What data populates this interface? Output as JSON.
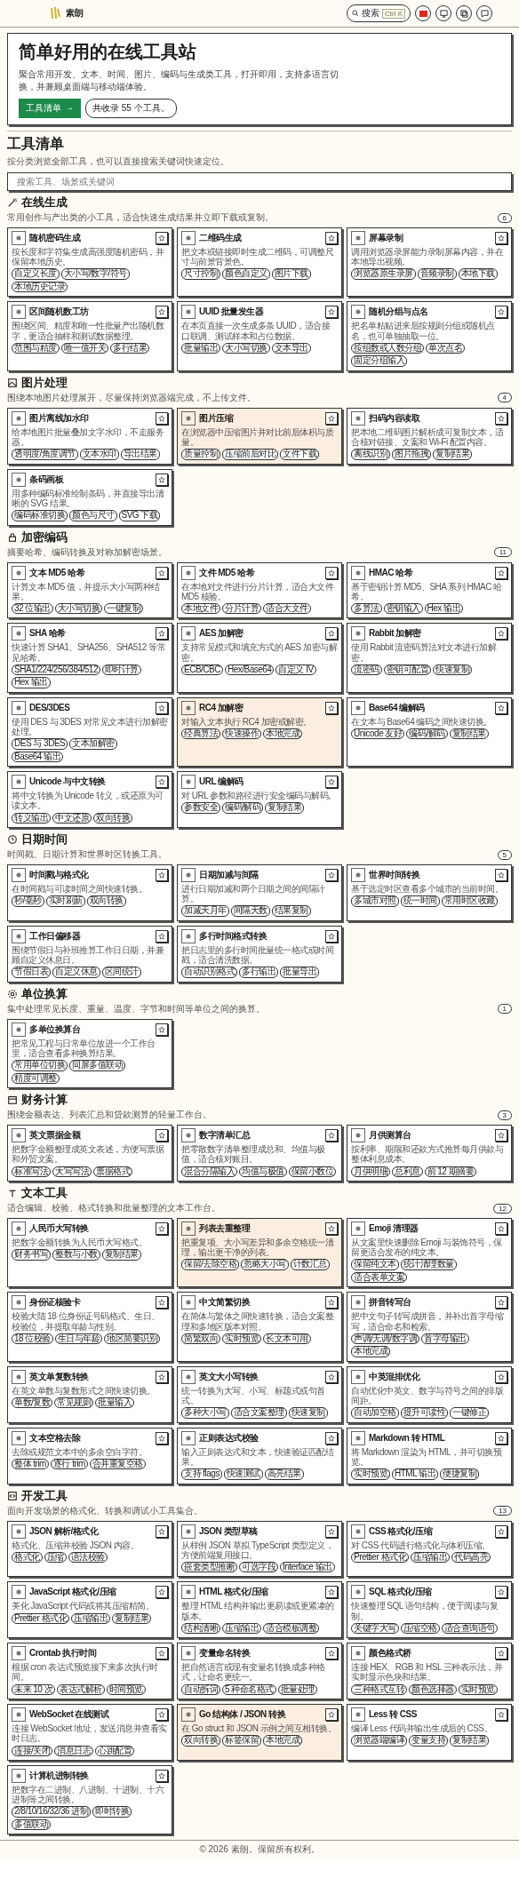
{
  "header": {
    "brand": "素朗",
    "search": {
      "label": "搜索",
      "shortcut": "Ctrl K"
    }
  },
  "hero": {
    "title": "简单好用的在线工具站",
    "description": "聚合常用开发、文本、时间、图片、编码与生成类工具，打开即用，支持多语言切换，并兼顾桌面端与移动端体验。",
    "primary_button": {
      "label": "工具清单",
      "arrow": "→"
    },
    "count_badge": "共收录 55 个工具。"
  },
  "catalog": {
    "title": "工具清单",
    "description": "按分类浏览全部工具，也可以直接搜索关键词快速定位。",
    "search": {
      "placeholder": "搜索工具、场景或关键词"
    }
  },
  "sections": [
    {
      "title": "在线生成",
      "description": "常用创作与产出类的小工具，适合快速生成结果并立即下载或复制。",
      "count": "6",
      "tools": [
        {
          "name": "随机密码生成",
          "description": "按长度和字符集生成高强度随机密码，并保留本地历史。",
          "tags": [
            "自定义长度",
            "大小写/数字/符号",
            "本地历史记录"
          ],
          "highlighted": false
        },
        {
          "name": "二维码生成",
          "description": "把文本或链接即时生成二维码，可调整尺寸与前景背景色。",
          "tags": [
            "尺寸控制",
            "颜色自定义",
            "图片下载"
          ],
          "highlighted": false
        },
        {
          "name": "屏幕录制",
          "description": "调用浏览器录屏能力录制屏幕内容，并在本地导出视频。",
          "tags": [
            "浏览器原生录屏",
            "音频录制",
            "本地下载"
          ],
          "highlighted": false
        },
        {
          "name": "区间随机数工坊",
          "description": "围绕区间、精度和唯一性批量产出随机数字，更适合抽样和测试数据整理。",
          "tags": [
            "范围与精度",
            "唯一值开关",
            "多行结果"
          ],
          "highlighted": false
        },
        {
          "name": "UUID 批量发生器",
          "description": "在本页直接一次生成多条 UUID，适合接口联调、测试样本和占位数据。",
          "tags": [
            "批量输出",
            "大小写切换",
            "文本导出"
          ],
          "highlighted": false
        },
        {
          "name": "随机分组与点名",
          "description": "把名单粘贴进来后按规则分组或随机点名，也可单独抽取一位。",
          "tags": [
            "按组数或人数分组",
            "单次点名",
            "固定分组输入"
          ],
          "highlighted": false
        }
      ]
    },
    {
      "title": "图片处理",
      "description": "围绕本地图片处理展开，尽量保持浏览器端完成，不上传文件。",
      "count": "4",
      "tools": [
        {
          "name": "图片离线加水印",
          "description": "给本地图片批量叠加文字水印，不走服务器。",
          "tags": [
            "透明度/角度调节",
            "文本水印",
            "导出结果"
          ],
          "highlighted": false
        },
        {
          "name": "图片压缩",
          "description": "在浏览器中压缩图片并对比前后体积与质量。",
          "tags": [
            "质量控制",
            "压缩前后对比",
            "文件下载"
          ],
          "highlighted": true
        },
        {
          "name": "扫码内容读取",
          "description": "把本地二维码图片解析成可复制文本，适合核对链接、文案和 Wi-Fi 配置内容。",
          "tags": [
            "离线识别",
            "图片拖拽",
            "复制结果"
          ],
          "highlighted": false
        },
        {
          "name": "条码画板",
          "description": "用多种编码标准绘制条码，并直接导出清晰的 SVG 结果。",
          "tags": [
            "编码标准切换",
            "颜色与尺寸",
            "SVG 下载"
          ],
          "highlighted": false
        }
      ]
    },
    {
      "title": "加密编码",
      "description": "摘要哈希、编码转换及对称加解密场景。",
      "count": "11",
      "tools": [
        {
          "name": "文本 MD5 哈希",
          "description": "计算文本 MD5 值，并提示大小写两种结果。",
          "tags": [
            "32 位输出",
            "大小写切换",
            "一键复制"
          ],
          "highlighted": false
        },
        {
          "name": "文件 MD5 哈希",
          "description": "在本地对文件进行分片计算，适合大文件 MD5 核验。",
          "tags": [
            "本地文件",
            "分片计算",
            "适合大文件"
          ],
          "highlighted": false
        },
        {
          "name": "HMAC 哈希",
          "description": "基于密钥计算 MD5、SHA 系列 HMAC 哈希。",
          "tags": [
            "多算法",
            "密钥输入",
            "Hex 输出"
          ],
          "highlighted": false
        },
        {
          "name": "SHA 哈希",
          "description": "快速计算 SHA1、SHA256、SHA512 等常见哈希。",
          "tags": [
            "SHA1/224/256/384/512",
            "即时计算",
            "Hex 输出"
          ],
          "highlighted": false
        },
        {
          "name": "AES 加解密",
          "description": "支持常见模式和填充方式的 AES 加密与解密。",
          "tags": [
            "ECB/CBC",
            "Hex/Base64",
            "自定义 IV"
          ],
          "highlighted": false
        },
        {
          "name": "Rabbit 加解密",
          "description": "使用 Rabbit 流密码算法对文本进行加解密。",
          "tags": [
            "流密码",
            "密钥可配置",
            "快速复制"
          ],
          "highlighted": false
        },
        {
          "name": "DES/3DES",
          "description": "使用 DES 与 3DES 对常见文本进行加解密处理。",
          "tags": [
            "DES 与 3DES",
            "文本加解密",
            "Base64 输出"
          ],
          "highlighted": false
        },
        {
          "name": "RC4 加解密",
          "description": "对输入文本执行 RC4 加密或解密。",
          "tags": [
            "经典算法",
            "快速操作",
            "本地完成"
          ],
          "highlighted": true
        },
        {
          "name": "Base64 编解码",
          "description": "在文本与 Base64 编码之间快速切换。",
          "tags": [
            "Unicode 友好",
            "编码/解码",
            "复制结果"
          ],
          "highlighted": false
        },
        {
          "name": "Unicode 与中文转换",
          "description": "将中文转换为 Unicode 转义，或还原为可读文本。",
          "tags": [
            "转义输出",
            "中文还原",
            "双向转换"
          ],
          "highlighted": false
        },
        {
          "name": "URL 编解码",
          "description": "对 URL 参数和路径进行安全编码与解码。",
          "tags": [
            "参数安全",
            "编码/解码",
            "复制结果"
          ],
          "highlighted": false
        }
      ]
    },
    {
      "title": "日期时间",
      "description": "时间戳、日期计算和世界时区转换工具。",
      "count": "5",
      "tools": [
        {
          "name": "时间戳与格式化",
          "description": "在时间戳与可读时间之间快速转换。",
          "tags": [
            "秒/毫秒",
            "实时刷新",
            "双向转换"
          ],
          "highlighted": false
        },
        {
          "name": "日期加减与间隔",
          "description": "进行日期加减和两个日期之间的间隔计算。",
          "tags": [
            "加减天月年",
            "间隔天数",
            "结果复制"
          ],
          "highlighted": false
        },
        {
          "name": "世界时间转换",
          "description": "基于选定时区查看多个城市的当前时间。",
          "tags": [
            "多城市对照",
            "统一时间",
            "常用时区收藏"
          ],
          "highlighted": false
        },
        {
          "name": "工作日偏移器",
          "description": "围绕节假日与补班推算工作日日期，并兼顾自定义休息日。",
          "tags": [
            "节假日表",
            "自定义休息",
            "区间统计"
          ],
          "highlighted": false
        },
        {
          "name": "多行时间格式转换",
          "description": "把日志里的多行时间批量统一格式或时间戳，适合清洗数据。",
          "tags": [
            "自动识别格式",
            "多行输出",
            "批量导出"
          ],
          "highlighted": false
        }
      ]
    },
    {
      "title": "单位换算",
      "description": "集中处理常见长度、重量、温度、字节和时间等单位之间的换算。",
      "count": "1",
      "tools": [
        {
          "name": "多单位换算台",
          "description": "把常见工程与日常单位放进一个工作台里，适合查看多种换算结果。",
          "tags": [
            "常用单位切换",
            "同屏多值联动",
            "精度可调整"
          ],
          "highlighted": false
        }
      ]
    },
    {
      "title": "财务计算",
      "description": "围绕金额表达、列表汇总和贷款测算的轻量工作台。",
      "count": "3",
      "tools": [
        {
          "name": "英文票据金额",
          "description": "把数字金额整理成英文表述，方便写票据和外贸文案。",
          "tags": [
            "标准写法",
            "大写写法",
            "票据格式"
          ],
          "highlighted": false
        },
        {
          "name": "数字清单汇总",
          "description": "把零散数字清单整理成总和、均值与极值，适合核对账目。",
          "tags": [
            "混合分隔输入",
            "均值与极值",
            "保留小数位"
          ],
          "highlighted": false
        },
        {
          "name": "月供测算台",
          "description": "按利率、期限和还款方式推算每月供款与整体利息成本。",
          "tags": [
            "月供明细",
            "总利息",
            "前 12 期摘要"
          ],
          "highlighted": false
        }
      ]
    },
    {
      "title": "文本工具",
      "description": "适合编辑、校验、格式转换和批量整理的文本工作台。",
      "count": "12",
      "tools": [
        {
          "name": "人民币大写转换",
          "description": "把数字金额转换为人民币大写格式。",
          "tags": [
            "财务书写",
            "整数与小数",
            "复制结果"
          ],
          "highlighted": false
        },
        {
          "name": "列表去重整理",
          "description": "把重复项、大小写差异和多余空格统一清理，输出更干净的列表。",
          "tags": [
            "保留/去除空格",
            "忽略大小写",
            "计数汇总"
          ],
          "highlighted": true
        },
        {
          "name": "Emoji 清理器",
          "description": "从文案里快速删除 Emoji 与装饰符号，保留更适合发布的纯文本。",
          "tags": [
            "保留纯文本",
            "统计清理数量",
            "适合表单文案"
          ],
          "highlighted": false
        },
        {
          "name": "身份证核验卡",
          "description": "校验大陆 18 位身份证号码格式、生日、校验位，并提取年龄与性别。",
          "tags": [
            "18 位校验",
            "生日与年龄",
            "地区简要识别"
          ],
          "highlighted": false
        },
        {
          "name": "中文简繁切换",
          "description": "在简体与繁体之间快速转换，适合文案整理和多地区版本对照。",
          "tags": [
            "简繁双向",
            "实时预览",
            "长文本可用"
          ],
          "highlighted": false
        },
        {
          "name": "拼音转写台",
          "description": "把中文句子转写成拼音，并补出首字母缩写，适合命名和检索。",
          "tags": [
            "声调/无调/数字调",
            "首字母输出",
            "本地完成"
          ],
          "highlighted": false
        },
        {
          "name": "英文单复数转换",
          "description": "在英文单数与复数形式之间快速切换。",
          "tags": [
            "单数/复数",
            "常见规则",
            "批量输入"
          ],
          "highlighted": false
        },
        {
          "name": "英文大小写转换",
          "description": "统一转换为大写、小写、标题式或句首式。",
          "tags": [
            "多种大小写",
            "适合文案整理",
            "快速复制"
          ],
          "highlighted": false
        },
        {
          "name": "中英混排优化",
          "description": "自动优化中英文、数字与符号之间的排版间距。",
          "tags": [
            "自动加空格",
            "提升可读性",
            "一键修正"
          ],
          "highlighted": false
        },
        {
          "name": "文本空格去除",
          "description": "去除或规范文本中的多余空白字符。",
          "tags": [
            "整体 trim",
            "逐行 trim",
            "合并重复空格"
          ],
          "highlighted": false
        },
        {
          "name": "正则表达式校验",
          "description": "输入正则表达式和文本，快速验证匹配结果。",
          "tags": [
            "支持 flags",
            "快速测试",
            "高亮结果"
          ],
          "highlighted": false
        },
        {
          "name": "Markdown 转 HTML",
          "description": "将 Markdown 渲染为 HTML，并可切换预览。",
          "tags": [
            "实时预览",
            "HTML 输出",
            "便捷复制"
          ],
          "highlighted": false
        }
      ]
    },
    {
      "title": "开发工具",
      "description": "面向开发场景的格式化、转换和调试小工具集合。",
      "count": "13",
      "tools": [
        {
          "name": "JSON 解析/格式化",
          "description": "格式化、压缩并校验 JSON 内容。",
          "tags": [
            "格式化",
            "压缩",
            "语法校验"
          ],
          "highlighted": false
        },
        {
          "name": "JSON 类型草稿",
          "description": "从样例 JSON 草拟 TypeScript 类型定义，方便前端复用接口。",
          "tags": [
            "嵌套类型推断",
            "可选字段",
            "Interface 输出"
          ],
          "highlighted": false
        },
        {
          "name": "CSS 格式化/压缩",
          "description": "对 CSS 代码进行格式化与体积压缩。",
          "tags": [
            "Prettier 格式化",
            "压缩输出",
            "代码高亮"
          ],
          "highlighted": false
        },
        {
          "name": "JavaScript 格式化/压缩",
          "description": "美化 JavaScript 代码或将其压缩精简。",
          "tags": [
            "Prettier 格式化",
            "压缩输出",
            "复制结果"
          ],
          "highlighted": false
        },
        {
          "name": "HTML 格式化/压缩",
          "description": "整理 HTML 结构并输出更易读或更紧凑的版本。",
          "tags": [
            "结构清晰",
            "压缩输出",
            "适合模板调整"
          ],
          "highlighted": false
        },
        {
          "name": "SQL 格式化/压缩",
          "description": "快速整理 SQL 语句结构，便于阅读与复制。",
          "tags": [
            "关键字大写",
            "压缩空格",
            "适合查询语句"
          ],
          "highlighted": false
        },
        {
          "name": "Crontab 执行时间",
          "description": "根据 cron 表达式预览接下来多次执行时间。",
          "tags": [
            "未来 10 次",
            "表达式解析",
            "时间预览"
          ],
          "highlighted": false
        },
        {
          "name": "变量命名转换",
          "description": "把自然语言或现有变量名转换成多种格式，让命名更统一。",
          "tags": [
            "自动拆词",
            "5 种命名格式",
            "批量处理"
          ],
          "highlighted": false
        },
        {
          "name": "颜色格式桥",
          "description": "连接 HEX、RGB 和 HSL 三种表示法，并实时显示色块和结果。",
          "tags": [
            "三种格式互转",
            "颜色选择器",
            "实时预览"
          ],
          "highlighted": false
        },
        {
          "name": "WebSocket 在线测试",
          "description": "连接 WebSocket 地址，发送消息并查看实时日志。",
          "tags": [
            "连接/关闭",
            "消息日志",
            "心跳配置"
          ],
          "highlighted": false
        },
        {
          "name": "Go 结构体 / JSON 转换",
          "description": "在 Go struct 和 JSON 示例之间互相转换。",
          "tags": [
            "双向转换",
            "标签保留",
            "本地完成"
          ],
          "highlighted": true
        },
        {
          "name": "Less 转 CSS",
          "description": "编译 Less 代码并输出生成后的 CSS。",
          "tags": [
            "浏览器端编译",
            "变量支持",
            "复制结果"
          ],
          "highlighted": false
        },
        {
          "name": "计算机进制转换",
          "description": "把数字在二进制、八进制、十进制、十六进制等之间转换。",
          "tags": [
            "2/8/10/16/32/36 进制",
            "即时转换",
            "多值联动"
          ],
          "highlighted": false
        }
      ]
    }
  ],
  "footer": "© 2026 素朗。保留所有权利。"
}
